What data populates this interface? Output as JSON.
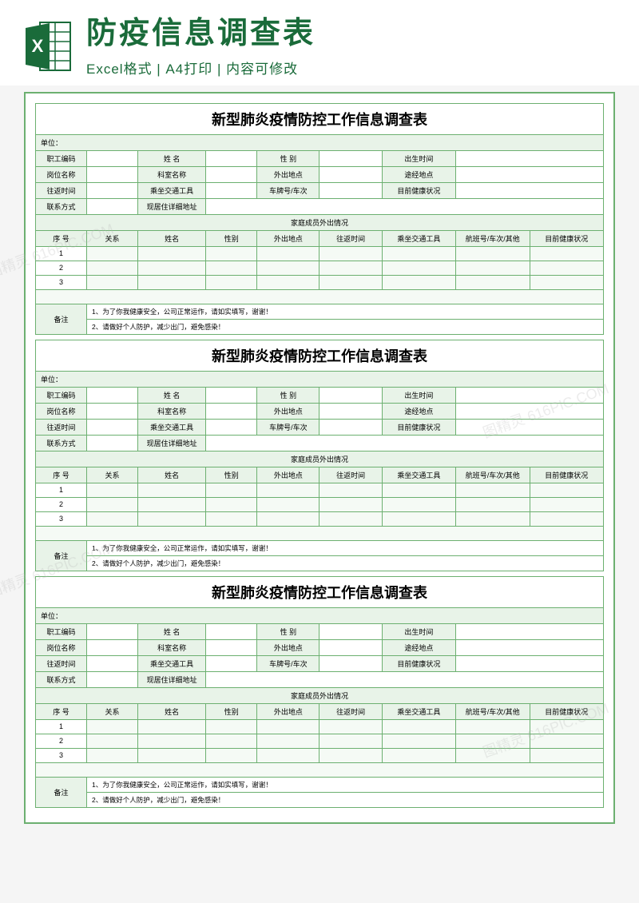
{
  "header": {
    "main_title": "防疫信息调查表",
    "sub_title": "Excel格式 | A4打印 | 内容可修改"
  },
  "form": {
    "title": "新型肺炎疫情防控工作信息调查表",
    "unit_label": "单位：",
    "row1": {
      "a": "职工编码",
      "b": "姓 名",
      "c": "性 别",
      "d": "出生时间"
    },
    "row2": {
      "a": "岗位名称",
      "b": "科室名称",
      "c": "外出地点",
      "d": "途经地点"
    },
    "row3": {
      "a": "往返时间",
      "b": "乘坐交通工具",
      "c": "车牌号/车次",
      "d": "目前健康状况"
    },
    "row4": {
      "a": "联系方式",
      "b": "现居住详细地址"
    },
    "family_section": "家庭成员外出情况",
    "cols": {
      "c1": "序 号",
      "c2": "关系",
      "c3": "姓名",
      "c4": "性别",
      "c5": "外出地点",
      "c6": "往返时间",
      "c7": "乘坐交通工具",
      "c8": "航班号/车次/其他",
      "c9": "目前健康状况"
    },
    "nums": {
      "n1": "1",
      "n2": "2",
      "n3": "3"
    },
    "remark_label": "备注",
    "remark1": "1、为了你我健康安全，公司正常运作，请如实填写，谢谢！",
    "remark2": "2、请做好个人防护，减少出门，避免感染！"
  },
  "watermark": "图精灵 616PIC.COM"
}
